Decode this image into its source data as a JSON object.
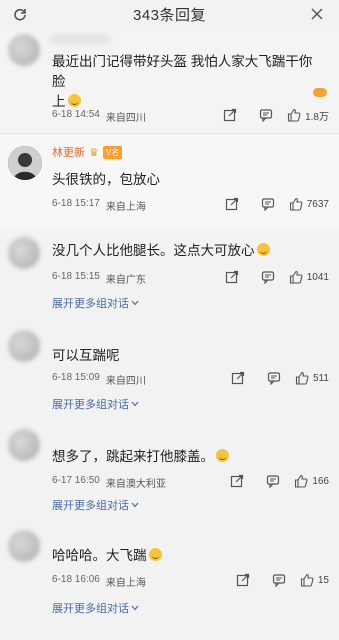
{
  "header": {
    "title": "343条回复"
  },
  "comments": [
    {
      "text_line1": "最近出门记得带好头盔 我怕人家大飞踹干你脸",
      "text_line2": "上",
      "date": "6-18 14:54",
      "location": "来自四川",
      "likes": "1.8万"
    },
    {
      "username": "林更新",
      "badge": "V名",
      "text": "头很铁的，包放心",
      "date": "6-18 15:17",
      "location": "来自上海",
      "likes": "7637"
    },
    {
      "text": "没几个人比他腿长。这点大可放心",
      "date": "6-18 15:15",
      "location": "来自广东",
      "likes": "1041",
      "more": "展开更多组对话"
    },
    {
      "text": "可以互踹呢",
      "date": "6-18 15:09",
      "location": "来自四川",
      "likes": "511",
      "more": "展开更多组对话"
    },
    {
      "text": "想多了，跳起来打他膝盖。",
      "date": "6-17 16:50",
      "location": "来自澳大利亚",
      "likes": "166",
      "more": "展开更多组对话"
    },
    {
      "text": "哈哈哈。大飞踹",
      "date": "6-18 16:06",
      "location": "来自上海",
      "likes": "15",
      "more": "展开更多组对话"
    }
  ],
  "icons": {
    "refresh": "refresh-icon",
    "close": "close-icon",
    "share": "share-icon",
    "comment": "comment-icon",
    "like": "thumbs-up-icon",
    "chevron": "chevron-down-icon"
  },
  "colors": {
    "username_orange": "#e36b2f",
    "link_blue": "#4a6aa5"
  }
}
